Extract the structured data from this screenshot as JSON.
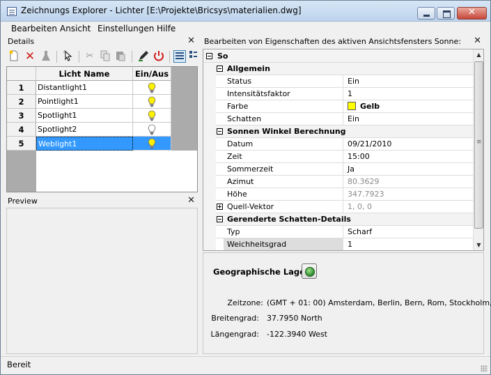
{
  "window": {
    "title": "Zeichnungs Explorer - Lichter [E:\\Projekte\\Bricsys\\materialien.dwg]",
    "close_glyph": "✕"
  },
  "menu": [
    "Bearbeiten",
    "Ansicht",
    "Einstellungen",
    "Hilfe"
  ],
  "details_panel": {
    "title": "Details",
    "close_glyph": "✕",
    "toolbar_icons": [
      "new-icon",
      "delete-icon",
      "purge-icon",
      "select-icon",
      "cut-icon",
      "copy-icon",
      "paste-icon",
      "edit-icon",
      "power-icon",
      "list-view-icon",
      "detail-view-icon"
    ],
    "columns": [
      "Licht Name",
      "Ein/Aus"
    ],
    "rows": [
      {
        "num": "1",
        "name": "Distantlight1",
        "on": true
      },
      {
        "num": "2",
        "name": "Pointlight1",
        "on": true
      },
      {
        "num": "3",
        "name": "Spotlight1",
        "on": true
      },
      {
        "num": "4",
        "name": "Spotlight2",
        "on": false
      },
      {
        "num": "5",
        "name": "Weblight1",
        "on": true
      }
    ],
    "selected_row": 4
  },
  "preview_panel": {
    "title": "Preview",
    "close_glyph": "✕"
  },
  "properties_panel": {
    "title": "Bearbeiten von Eigenschaften des aktiven Ansichtsfensters Sonne:",
    "close_glyph": "✕",
    "root": "So",
    "sections": [
      {
        "name": "Allgemein",
        "rows": [
          {
            "label": "Status",
            "value": "Ein"
          },
          {
            "label": "Intensitätsfaktor",
            "value": "1"
          },
          {
            "label": "Farbe",
            "value": "Gelb",
            "swatch": "#ffff00"
          },
          {
            "label": "Schatten",
            "value": "Ein"
          }
        ]
      },
      {
        "name": "Sonnen Winkel Berechnung",
        "rows": [
          {
            "label": "Datum",
            "value": "09/21/2010"
          },
          {
            "label": "Zeit",
            "value": "15:00"
          },
          {
            "label": "Sommerzeit",
            "value": "Ja"
          },
          {
            "label": "Azimut",
            "value": "80.3629"
          },
          {
            "label": "Höhe",
            "value": "347.7923"
          },
          {
            "label": "Quell-Vektor",
            "value": "1, 0, 0"
          }
        ]
      },
      {
        "name": "Gerenderte Schatten-Details",
        "rows": [
          {
            "label": "Typ",
            "value": "Scharf"
          },
          {
            "label": "Weichheitsgrad",
            "value": "1"
          }
        ]
      }
    ]
  },
  "geo": {
    "title": "Geographische Lage",
    "timezone_label": "Zeitzone:",
    "timezone_value": "(GMT + 01: 00) Amsterdam, Berlin, Bern, Rom, Stockholm,",
    "latitude_label": "Breitengrad:",
    "latitude_value": "37.7950 North",
    "longitude_label": "Längengrad:",
    "longitude_value": "-122.3940 West"
  },
  "status": "Bereit"
}
